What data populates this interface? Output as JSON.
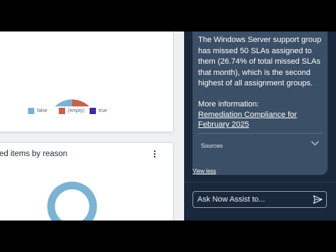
{
  "dashboard": {
    "card1": {
      "legend": [
        {
          "label": "false",
          "color": "#7ab3d4"
        },
        {
          "label": "(empty)",
          "color": "#c8604a"
        },
        {
          "label": "true",
          "color": "#3d2aa6"
        }
      ]
    },
    "card2": {
      "title": "ed items by reason",
      "menu_icon": "kebab-icon"
    }
  },
  "assistant": {
    "message": "The Windows Server support group has missed 50 SLAs assigned to them (26.74% of total missed SLAs that month), which is the second highest of all assignment groups.",
    "more_info_label": "More information:",
    "more_info_link": "Remediation Compliance for February 2025",
    "sources_label": "Sources",
    "view_less": "View less",
    "input_placeholder": "Ask Now Assist to...",
    "send_icon": "send-icon",
    "expand_icon": "chevron-down-icon"
  }
}
